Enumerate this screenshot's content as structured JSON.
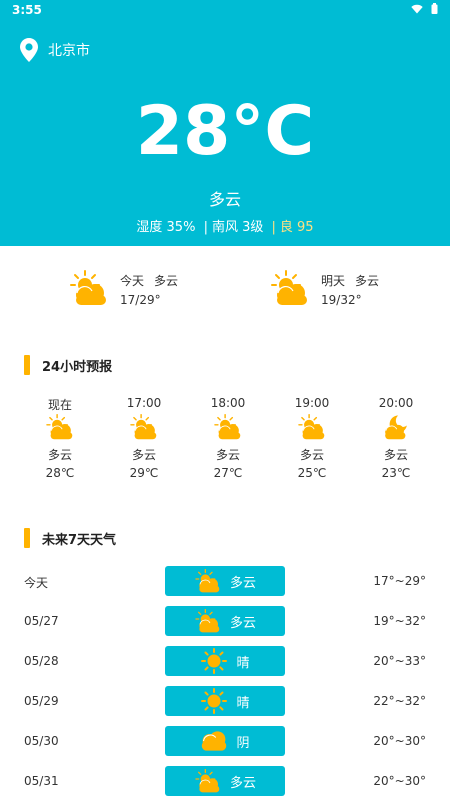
{
  "status_bar": {
    "time": "3:55",
    "icons": [
      "wifi-icon",
      "battery-icon"
    ]
  },
  "location": {
    "city": "北京市",
    "icon": "location-pin-icon"
  },
  "current": {
    "temperature": "28°C",
    "condition": "多云",
    "humidity": "湿度 35%",
    "wind": "南风 3级",
    "aqi": "良 95",
    "separator": "|"
  },
  "summary": [
    {
      "label": "今天",
      "condition": "多云",
      "range": "17/29°",
      "icon": "partly-cloudy-icon"
    },
    {
      "label": "明天",
      "condition": "多云",
      "range": "19/32°",
      "icon": "partly-cloudy-icon"
    }
  ],
  "hourly_title": "24小时预报",
  "hourly": [
    {
      "time": "现在",
      "condition": "多云",
      "temp": "28℃",
      "icon": "partly-cloudy-icon"
    },
    {
      "time": "17:00",
      "condition": "多云",
      "temp": "29℃",
      "icon": "partly-cloudy-icon"
    },
    {
      "time": "18:00",
      "condition": "多云",
      "temp": "27℃",
      "icon": "partly-cloudy-icon"
    },
    {
      "time": "19:00",
      "condition": "多云",
      "temp": "25℃",
      "icon": "partly-cloudy-icon"
    },
    {
      "time": "20:00",
      "condition": "多云",
      "temp": "23℃",
      "icon": "partly-cloudy-night-icon"
    }
  ],
  "daily_title": "未来7天天气",
  "daily": [
    {
      "date": "今天",
      "condition": "多云",
      "range": "17°~29°",
      "icon": "partly-cloudy-icon"
    },
    {
      "date": "05/27",
      "condition": "多云",
      "range": "19°~32°",
      "icon": "partly-cloudy-icon"
    },
    {
      "date": "05/28",
      "condition": "晴",
      "range": "20°~33°",
      "icon": "sunny-icon"
    },
    {
      "date": "05/29",
      "condition": "晴",
      "range": "22°~32°",
      "icon": "sunny-icon"
    },
    {
      "date": "05/30",
      "condition": "阴",
      "range": "20°~30°",
      "icon": "overcast-icon"
    },
    {
      "date": "05/31",
      "condition": "多云",
      "range": "20°~30°",
      "icon": "partly-cloudy-icon"
    }
  ],
  "colors": {
    "primary": "#00bcd4",
    "accent": "#ffb300",
    "aqi": "#ffe082"
  }
}
